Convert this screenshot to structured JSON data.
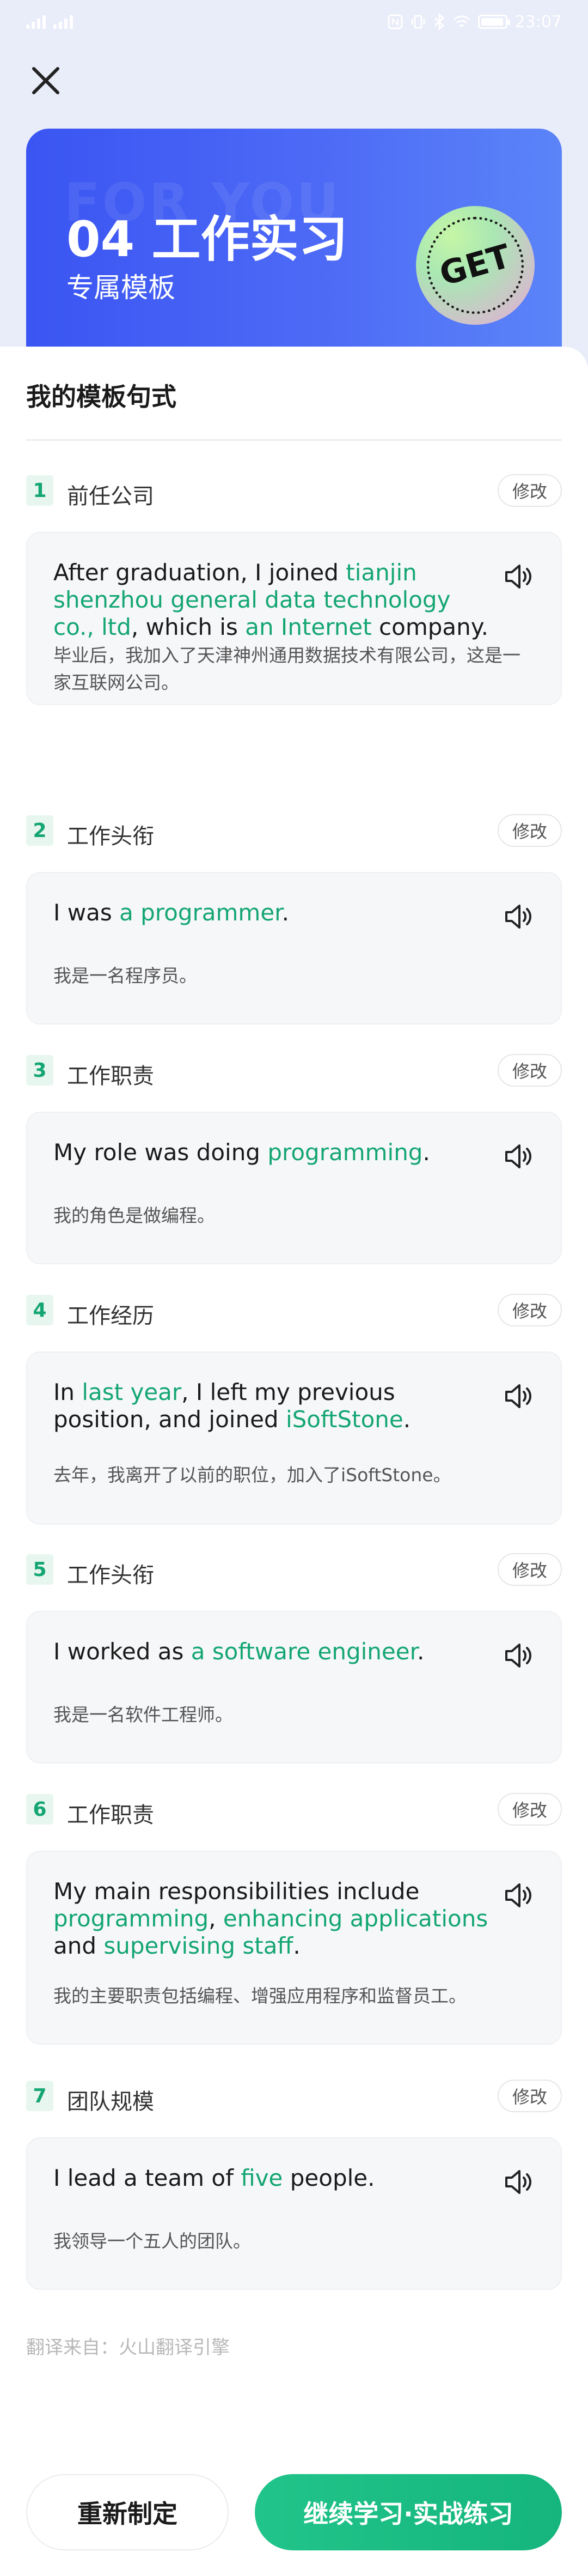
{
  "status_bar": {
    "time": "23:07"
  },
  "hero": {
    "watermark": "FOR YOU",
    "title": "04 工作实习",
    "subtitle": "专属模板",
    "badge": "GET"
  },
  "section_title": "我的模板句式",
  "edit_label": "修改",
  "items": [
    {
      "num": "1",
      "label": "前任公司",
      "en": [
        {
          "t": "After graduation, I joined ",
          "h": false
        },
        {
          "t": "tianjin shenzhou general data technology co., ltd",
          "h": true
        },
        {
          "t": ", which is ",
          "h": false
        },
        {
          "t": "an Internet",
          "h": true
        },
        {
          "t": " company.",
          "h": false
        }
      ],
      "zh": "毕业后，我加入了天津神州通用数据技术有限公司，这是一家互联网公司。"
    },
    {
      "num": "2",
      "label": "工作头衔",
      "en": [
        {
          "t": "I was ",
          "h": false
        },
        {
          "t": "a programmer",
          "h": true
        },
        {
          "t": ".",
          "h": false
        }
      ],
      "zh": "我是一名程序员。"
    },
    {
      "num": "3",
      "label": "工作职责",
      "en": [
        {
          "t": "My role was doing ",
          "h": false
        },
        {
          "t": "programming",
          "h": true
        },
        {
          "t": ".",
          "h": false
        }
      ],
      "zh": "我的角色是做编程。"
    },
    {
      "num": "4",
      "label": "工作经历",
      "en": [
        {
          "t": "In ",
          "h": false
        },
        {
          "t": "last year",
          "h": true
        },
        {
          "t": ", I left my previous position, and joined ",
          "h": false
        },
        {
          "t": "iSoftStone",
          "h": true
        },
        {
          "t": ".",
          "h": false
        }
      ],
      "zh": "去年，我离开了以前的职位，加入了iSoftStone。"
    },
    {
      "num": "5",
      "label": "工作头衔",
      "en": [
        {
          "t": " I worked as ",
          "h": false
        },
        {
          "t": "a software engineer",
          "h": true
        },
        {
          "t": ".",
          "h": false
        }
      ],
      "zh": "我是一名软件工程师。"
    },
    {
      "num": "6",
      "label": "工作职责",
      "en": [
        {
          "t": "My main responsibilities include ",
          "h": false
        },
        {
          "t": "programming",
          "h": true
        },
        {
          "t": ", ",
          "h": false
        },
        {
          "t": "enhancing applications",
          "h": true
        },
        {
          "t": " and ",
          "h": false
        },
        {
          "t": "supervising staff",
          "h": true
        },
        {
          "t": ".",
          "h": false
        }
      ],
      "zh": "我的主要职责包括编程、增强应用程序和监督员工。"
    },
    {
      "num": "7",
      "label": "团队规模",
      "en": [
        {
          "t": " I lead a team of ",
          "h": false
        },
        {
          "t": "five",
          "h": true
        },
        {
          "t": " people.",
          "h": false
        }
      ],
      "zh": "我领导一个五人的团队。"
    }
  ],
  "translate_note": "翻译来自：火山翻译引擎",
  "buttons": {
    "redo": "重新制定",
    "continue": "继续学习·实战练习"
  },
  "colors": {
    "accent_green": "#14a672",
    "hero_blue": "#3a55f2"
  }
}
